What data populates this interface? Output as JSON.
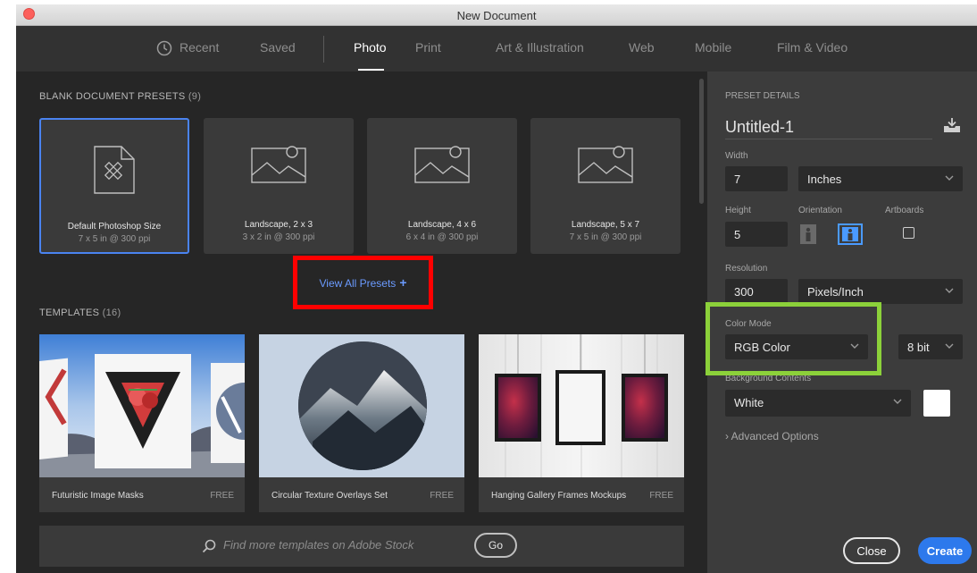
{
  "window": {
    "title": "New Document"
  },
  "tabs": [
    {
      "label": "Recent",
      "active": false
    },
    {
      "label": "Saved",
      "active": false
    },
    {
      "label": "Photo",
      "active": true
    },
    {
      "label": "Print",
      "active": false
    },
    {
      "label": "Art & Illustration",
      "active": false
    },
    {
      "label": "Web",
      "active": false
    },
    {
      "label": "Mobile",
      "active": false
    },
    {
      "label": "Film & Video",
      "active": false
    }
  ],
  "presets": {
    "heading": "BLANK DOCUMENT PRESETS",
    "count": "(9)",
    "items": [
      {
        "name": "Default Photoshop Size",
        "meta": "7 x 5 in @ 300 ppi",
        "icon": "document-icon",
        "selected": true
      },
      {
        "name": "Landscape, 2 x 3",
        "meta": "3 x 2 in @ 300 ppi",
        "icon": "image-icon",
        "selected": false
      },
      {
        "name": "Landscape, 4 x 6",
        "meta": "6 x 4 in @ 300 ppi",
        "icon": "image-icon",
        "selected": false
      },
      {
        "name": "Landscape, 5 x 7",
        "meta": "7 x 5 in @ 300 ppi",
        "icon": "image-icon",
        "selected": false
      }
    ],
    "view_all_label": "View All Presets",
    "view_all_plus": "+"
  },
  "templates": {
    "heading": "TEMPLATES",
    "count": "(16)",
    "items": [
      {
        "name": "Futuristic Image Masks",
        "badge": "FREE"
      },
      {
        "name": "Circular Texture Overlays Set",
        "badge": "FREE"
      },
      {
        "name": "Hanging Gallery Frames Mockups",
        "badge": "FREE"
      }
    ]
  },
  "stock": {
    "placeholder": "Find more templates on Adobe Stock",
    "go_label": "Go"
  },
  "details": {
    "heading": "PRESET DETAILS",
    "doc_name": "Untitled-1",
    "width_label": "Width",
    "width_value": "7",
    "width_unit": "Inches",
    "height_label": "Height",
    "height_value": "5",
    "orientation_label": "Orientation",
    "artboards_label": "Artboards",
    "resolution_label": "Resolution",
    "resolution_value": "300",
    "resolution_unit": "Pixels/Inch",
    "color_mode_label": "Color Mode",
    "color_mode_value": "RGB Color",
    "bit_depth": "8 bit",
    "background_label": "Background Contents",
    "background_value": "White",
    "advanced_label": "Advanced Options",
    "close_label": "Close",
    "create_label": "Create"
  },
  "colors": {
    "accent": "#2d79ec",
    "selection": "#4a83f0",
    "highlight_red": "#ff0000",
    "highlight_green": "#8cd13a"
  }
}
